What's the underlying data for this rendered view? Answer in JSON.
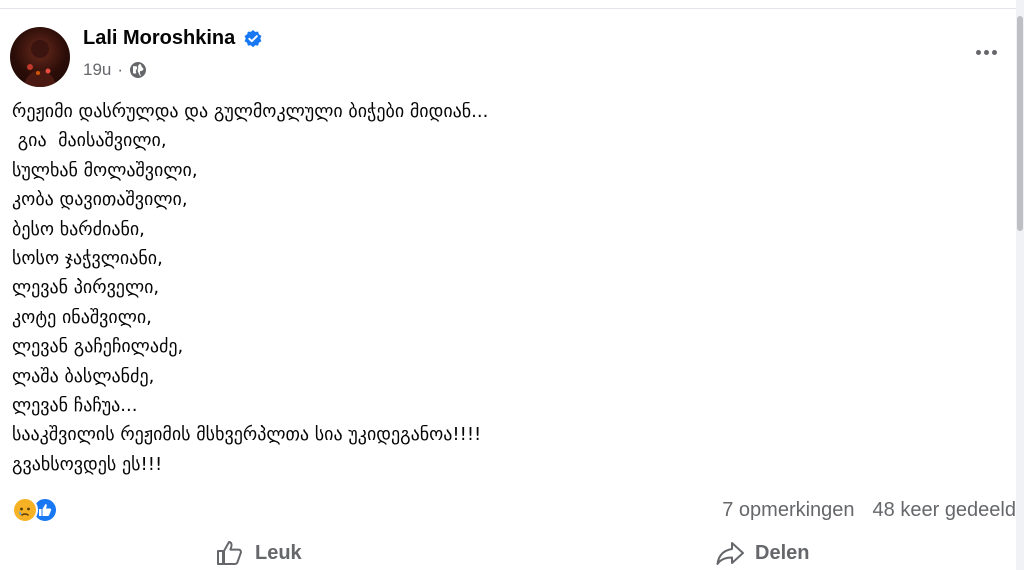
{
  "post": {
    "author": "Lali Moroshkina",
    "time": "19u",
    "separator": "·",
    "body": "რეჟიმი დასრულდა და გულმოკლული ბიჭები მიდიან...\n გია  მაისაშვილი,\nსულხან მოლაშვილი,\nკობა დავითაშვილი,\nბესო ხარძიანი,\nსოსო ჯაჭვლიანი,\nლევან პირველი,\nკოტე ინაშვილი,\nლევან გაჩეჩილაძე,\nლაშა ბასლანძე,\nლევან ჩაჩუა...\nსააკშვილის რეჟიმის მსხვერპლთა სია უკიდეგანოა!!!!\nგვახსოვდეს ეს!!!"
  },
  "stats": {
    "comments": "7 opmerkingen",
    "shares": "48 keer gedeeld"
  },
  "actions": {
    "like": "Leuk",
    "share": "Delen"
  },
  "colors": {
    "verified": "#1877f2",
    "secondary_text": "#65676b",
    "like_reaction": "#1877f2",
    "sad_reaction": "#f7b125"
  },
  "icons": {
    "verified": "verified-badge-icon",
    "audience": "globe-icon",
    "menu": "more-icon",
    "reactions": [
      "sad-reaction-icon",
      "like-reaction-icon"
    ],
    "like": "thumbs-up-icon",
    "share": "share-arrow-icon"
  }
}
